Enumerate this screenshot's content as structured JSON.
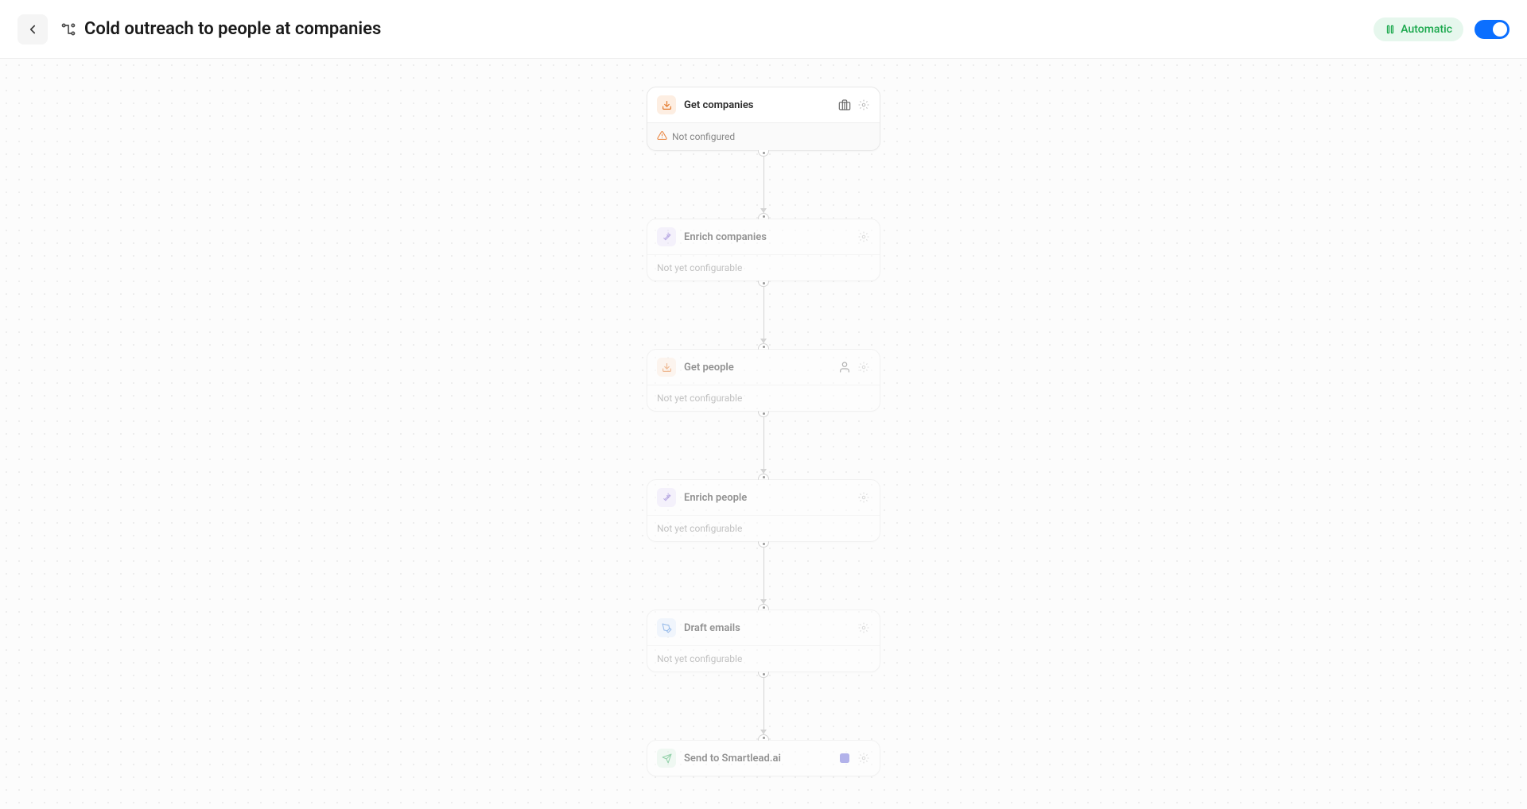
{
  "header": {
    "title": "Cold outreach to people at companies",
    "mode": "Automatic"
  },
  "nodes": [
    {
      "id": "get-companies",
      "title": "Get companies",
      "status": "Not configured",
      "statusType": "warning",
      "iconColor": "orange",
      "iconType": "download",
      "dimmed": false,
      "secondaryIcon": "briefcase"
    },
    {
      "id": "enrich-companies",
      "title": "Enrich companies",
      "status": "Not yet configurable",
      "statusType": "plain",
      "iconColor": "purple",
      "iconType": "sparkle",
      "dimmed": true,
      "secondaryIcon": null
    },
    {
      "id": "get-people",
      "title": "Get people",
      "status": "Not yet configurable",
      "statusType": "plain",
      "iconColor": "orange",
      "iconType": "download",
      "dimmed": true,
      "secondaryIcon": "person"
    },
    {
      "id": "enrich-people",
      "title": "Enrich people",
      "status": "Not yet configurable",
      "statusType": "plain",
      "iconColor": "purple",
      "iconType": "sparkle",
      "dimmed": true,
      "secondaryIcon": null
    },
    {
      "id": "draft-emails",
      "title": "Draft emails",
      "status": "Not yet configurable",
      "statusType": "plain",
      "iconColor": "blue",
      "iconType": "pen",
      "dimmed": true,
      "secondaryIcon": null
    },
    {
      "id": "send-smartlead",
      "title": "Send to Smartlead.ai",
      "status": "",
      "statusType": "plain",
      "iconColor": "green",
      "iconType": "send",
      "dimmed": true,
      "secondaryIcon": "app"
    }
  ]
}
